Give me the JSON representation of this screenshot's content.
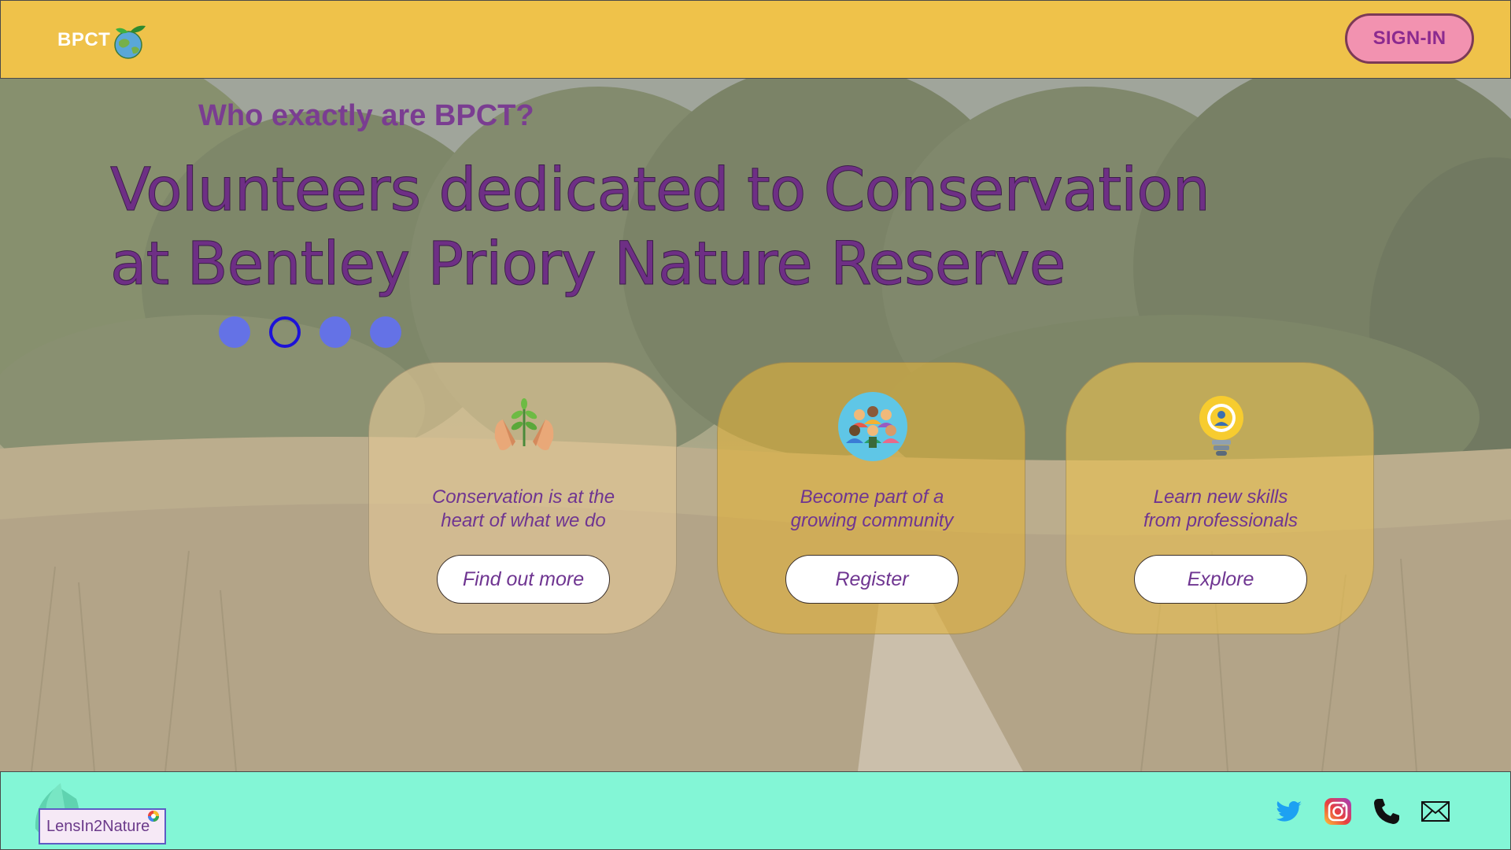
{
  "header": {
    "logo_text": "BPCT",
    "signin_label": "SIGN-IN"
  },
  "hero": {
    "subtitle": "Who exactly are BPCT?",
    "headline_line1": "Volunteers dedicated to Conservation",
    "headline_line2": "at Bentley Priory Nature Reserve",
    "carousel": {
      "total": 4,
      "active_index": 1
    }
  },
  "cards": [
    {
      "icon": "plant-hands-icon",
      "text_line1": "Conservation is at the",
      "text_line2": "heart of what we do",
      "button": "Find out more"
    },
    {
      "icon": "community-icon",
      "text_line1": "Become part of a",
      "text_line2": "growing community",
      "button": "Register"
    },
    {
      "icon": "lightbulb-icon",
      "text_line1": "Learn new skills",
      "text_line2": "from professionals",
      "button": "Explore"
    }
  ],
  "footer": {
    "brand": "LensIn2Nature",
    "social": [
      "twitter-icon",
      "instagram-icon",
      "phone-icon",
      "mail-icon"
    ]
  },
  "colors": {
    "header_bg": "#efc24a",
    "footer_bg": "#83f6d6",
    "accent_purple": "#6e2f85",
    "signin_bg": "#f292b0",
    "dot": "#6472e6",
    "dot_active": "#1d12d8"
  }
}
